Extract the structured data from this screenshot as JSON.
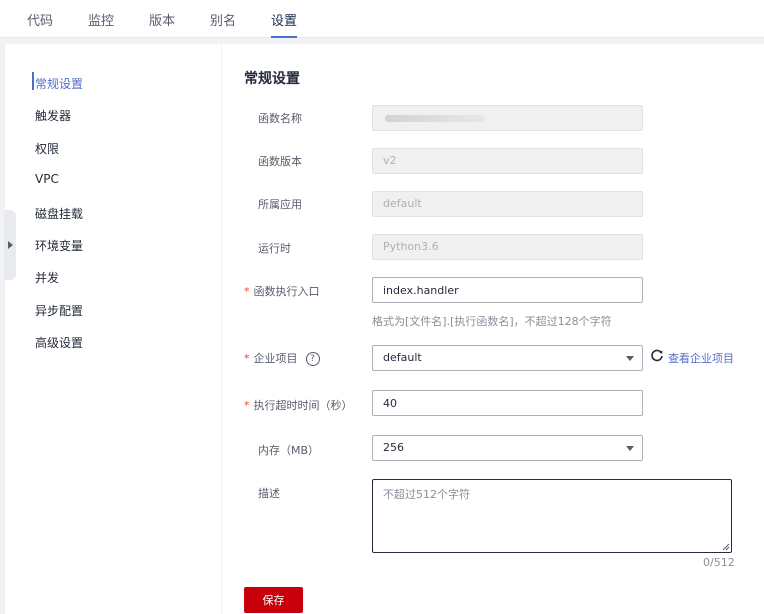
{
  "tabs": [
    {
      "label": "代码"
    },
    {
      "label": "监控"
    },
    {
      "label": "版本"
    },
    {
      "label": "别名"
    },
    {
      "label": "设置",
      "active": true
    }
  ],
  "sidebar": {
    "items": [
      {
        "label": "常规设置",
        "active": true
      },
      {
        "label": "触发器"
      },
      {
        "label": "权限"
      },
      {
        "label": "VPC"
      },
      {
        "label": "磁盘挂载"
      },
      {
        "label": "环境变量"
      },
      {
        "label": "并发"
      },
      {
        "label": "异步配置"
      },
      {
        "label": "高级设置"
      }
    ]
  },
  "form": {
    "title": "常规设置",
    "function_name": {
      "label": "函数名称"
    },
    "function_version": {
      "label": "函数版本",
      "value": "v2"
    },
    "application": {
      "label": "所属应用",
      "value": "default"
    },
    "runtime": {
      "label": "运行时",
      "value": "Python3.6"
    },
    "handler": {
      "label": "函数执行入口",
      "value": "index.handler",
      "hint": "格式为[文件名].[执行函数名]，不超过128个字符",
      "required": true
    },
    "enterprise_project": {
      "label": "企业项目",
      "value": "default",
      "link": "查看企业项目",
      "required": true,
      "help": "?"
    },
    "timeout": {
      "label": "执行超时时间（秒）",
      "value": "40",
      "required": true
    },
    "memory": {
      "label": "内存（MB）",
      "value": "256"
    },
    "description": {
      "label": "描述",
      "placeholder": "不超过512个字符",
      "counter": "0/512"
    },
    "save_label": "保存",
    "required_mark": "*"
  },
  "colors": {
    "accent": "#526ecc",
    "primary_button": "#c7000b",
    "required": "#e54545"
  },
  "icons": {
    "refresh": "refresh-icon",
    "help": "help-circle-icon",
    "dropdown": "chevron-down-icon",
    "collapse": "chevron-right-icon"
  }
}
